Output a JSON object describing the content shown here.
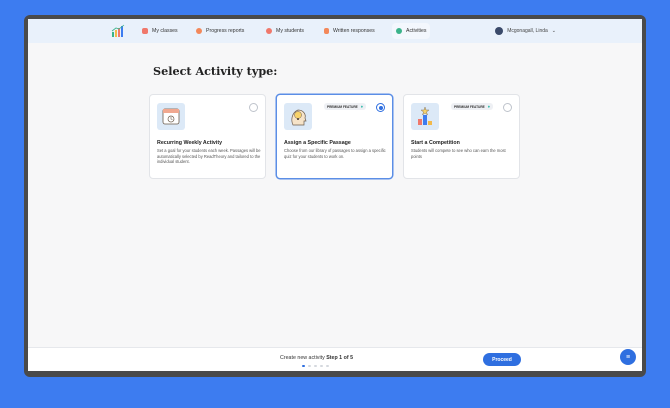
{
  "colors": {
    "accent": "#2f6fe0",
    "background": "#3d7cf0",
    "nav_bg": "#e9f1fb",
    "gem": "#27b6a6"
  },
  "nav": {
    "logo_icon": "bar-chart-logo-icon",
    "items": [
      {
        "label": "My classes",
        "icon": "classes-icon",
        "color": "#f0786b"
      },
      {
        "label": "Progress reports",
        "icon": "reports-icon",
        "color": "#f3885a"
      },
      {
        "label": "My students",
        "icon": "students-icon",
        "color": "#f0786b"
      },
      {
        "label": "Written responses",
        "icon": "responses-icon",
        "color": "#f3885a"
      },
      {
        "label": "Activities",
        "icon": "activities-icon",
        "color": "#3bb38a"
      }
    ],
    "user_name": "Mcgonagall, Linda"
  },
  "page_title": "Select Activity type:",
  "cards": [
    {
      "title": "Recurring Weekly Activity",
      "description": "Set a goal for your students each week. Passages will be automatically selected by ReadTheory and tailored to the individual student.",
      "badge": "",
      "selected": false,
      "icon": "calendar-icon"
    },
    {
      "title": "Assign a Specific Passage",
      "description": "Choose from our library of passages to assign a specific quiz for your students to work on.",
      "badge": "PREMIUM FEATURE",
      "selected": true,
      "icon": "lightbulb-head-icon"
    },
    {
      "title": "Start a Competition",
      "description": "Students will compete to see who can earn the most points",
      "badge": "PREMIUM FEATURE",
      "selected": false,
      "icon": "trophy-podium-icon"
    }
  ],
  "footer": {
    "step_prefix": "Create new activity",
    "step_label": "Step 1 of 5",
    "proceed_label": "Proceed",
    "current_step": 1,
    "total_steps": 5
  }
}
